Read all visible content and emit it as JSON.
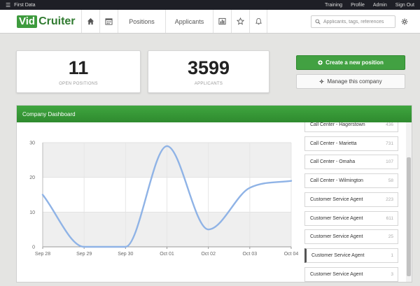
{
  "topbar": {
    "company": "First Data",
    "links": [
      "Training",
      "Profile",
      "Admin",
      "Sign Out"
    ]
  },
  "nav": {
    "logo_vid": "Vid",
    "logo_cruiter": "Cruiter",
    "positions_label": "Positions",
    "applicants_label": "Applicants",
    "search_placeholder": "Applicants, tags, references"
  },
  "stats": {
    "open_positions": {
      "value": "11",
      "label": "OPEN POSITIONS"
    },
    "applicants": {
      "value": "3599",
      "label": "APPLICANTS"
    }
  },
  "actions": {
    "create_label": "Create a new position",
    "manage_label": "Manage this company"
  },
  "dashboard": {
    "title": "Company Dashboard",
    "positions": [
      {
        "name": "Call Center - Hagerstown",
        "count": "436"
      },
      {
        "name": "Call Center - Marietta",
        "count": "731"
      },
      {
        "name": "Call Center - Omaha",
        "count": "107"
      },
      {
        "name": "Call Center - Wilmington",
        "count": "58"
      },
      {
        "name": "Customer Service Agent",
        "count": "223"
      },
      {
        "name": "Customer Service Agent",
        "count": "611"
      },
      {
        "name": "Customer Service Agent",
        "count": "25"
      },
      {
        "name": "Customer Service Agent",
        "count": "1"
      },
      {
        "name": "Customer Service Agent",
        "count": "3"
      }
    ]
  },
  "colors": {
    "brand_green": "#3e9b3e",
    "line": "#8fb3e6"
  },
  "chart_data": {
    "type": "line",
    "x": [
      "Sep 28",
      "Sep 29",
      "Sep 30",
      "Oct 01",
      "Oct 02",
      "Oct 03",
      "Oct 04"
    ],
    "series": [
      {
        "values": [
          15,
          0,
          0,
          29,
          5,
          17,
          19
        ]
      }
    ],
    "yticks": [
      "0",
      "10",
      "20",
      "30"
    ],
    "ylim": [
      0,
      30
    ],
    "grid": true,
    "smooth": true
  }
}
